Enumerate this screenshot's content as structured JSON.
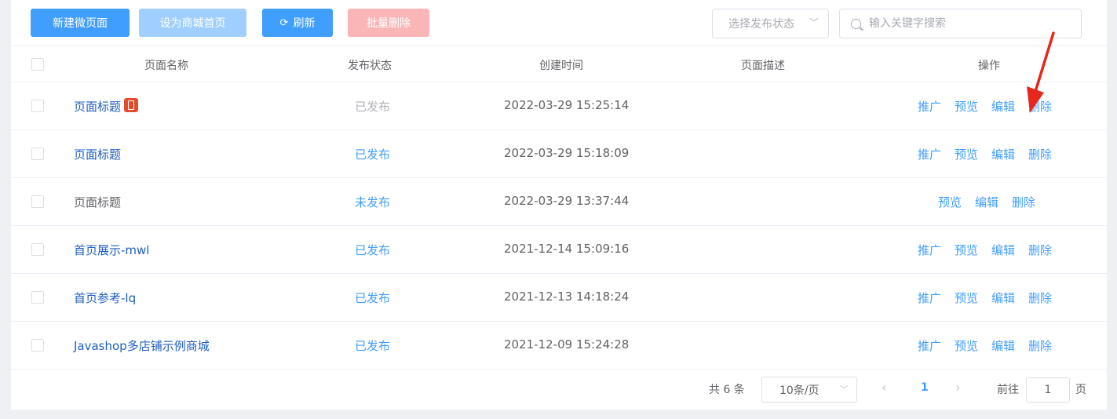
{
  "toolbar": {
    "new_label": "新建微页面",
    "set_home_label": "设为商城首页",
    "refresh_label": "刷新",
    "batch_delete_label": "批量删除",
    "status_select_placeholder": "选择发布状态",
    "search_placeholder": "输入关键字搜索"
  },
  "table": {
    "headers": {
      "name": "页面名称",
      "status": "发布状态",
      "created": "创建时间",
      "desc": "页面描述",
      "ops": "操作"
    },
    "rows": [
      {
        "name": "页面标题",
        "status": "已发布",
        "created": "2022-03-29 15:25:14",
        "ops": [
          "推广",
          "预览",
          "编辑",
          "删除"
        ]
      },
      {
        "name": "页面标题",
        "status": "已发布",
        "created": "2022-03-29 15:18:09",
        "ops": [
          "推广",
          "预览",
          "编辑",
          "删除"
        ]
      },
      {
        "name": "页面标题",
        "status": "未发布",
        "created": "2022-03-29 13:37:44",
        "ops": [
          "预览",
          "编辑",
          "删除"
        ]
      },
      {
        "name": "首页展示-mwl",
        "status": "已发布",
        "created": "2021-12-14 15:09:16",
        "ops": [
          "推广",
          "预览",
          "编辑",
          "删除"
        ]
      },
      {
        "name": "首页参考-lq",
        "status": "已发布",
        "created": "2021-12-13 14:18:24",
        "ops": [
          "推广",
          "预览",
          "编辑",
          "删除"
        ]
      },
      {
        "name": "Javashop多店铺示例商城",
        "status": "已发布",
        "created": "2021-12-09 15:24:28",
        "ops": [
          "推广",
          "预览",
          "编辑",
          "删除"
        ]
      }
    ]
  },
  "pagination": {
    "total_label": "共 6 条",
    "page_size": "10条/页",
    "current_page": "1",
    "goto_label": "前往",
    "goto_value": "1",
    "page_unit": "页"
  },
  "colors": {
    "primary": "#409eff",
    "primary_light": "#a0cfff",
    "danger_light": "#fab6b6",
    "arrow": "#e8271c",
    "home_badge": "#e34c2e"
  },
  "icons": [
    "refresh-icon",
    "chevron-down-icon",
    "search-icon",
    "home-page-badge-icon",
    "chevron-left-icon",
    "chevron-right-icon",
    "annotation-arrow"
  ]
}
